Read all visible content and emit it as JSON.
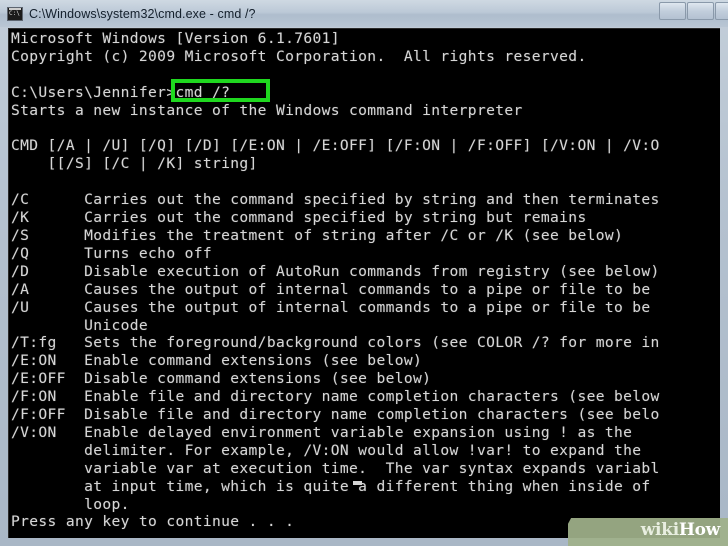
{
  "window": {
    "title": "C:\\Windows\\system32\\cmd.exe - cmd /?",
    "icon": "cmd-console-icon",
    "buttons": [
      {
        "name": "minimize-button",
        "glyph": ""
      },
      {
        "name": "maximize-button",
        "glyph": ""
      },
      {
        "name": "close-button",
        "glyph": ""
      }
    ]
  },
  "console": {
    "background_color": "#000000",
    "text_color": "#d6d6d6",
    "lines": [
      "Microsoft Windows [Version 6.1.7601]",
      "Copyright (c) 2009 Microsoft Corporation.  All rights reserved.",
      "",
      "C:\\Users\\Jennifer>cmd /?",
      "Starts a new instance of the Windows command interpreter",
      "",
      "CMD [/A | /U] [/Q] [/D] [/E:ON | /E:OFF] [/F:ON | /F:OFF] [/V:ON | /V:O",
      "    [[/S] [/C | /K] string]",
      "",
      "/C      Carries out the command specified by string and then terminates",
      "/K      Carries out the command specified by string but remains",
      "/S      Modifies the treatment of string after /C or /K (see below)",
      "/Q      Turns echo off",
      "/D      Disable execution of AutoRun commands from registry (see below)",
      "/A      Causes the output of internal commands to a pipe or file to be",
      "/U      Causes the output of internal commands to a pipe or file to be",
      "        Unicode",
      "/T:fg   Sets the foreground/background colors (see COLOR /? for more in",
      "/E:ON   Enable command extensions (see below)",
      "/E:OFF  Disable command extensions (see below)",
      "/F:ON   Enable file and directory name completion characters (see below",
      "/F:OFF  Disable file and directory name completion characters (see belo",
      "/V:ON   Enable delayed environment variable expansion using ! as the",
      "        delimiter. For example, /V:ON would allow !var! to expand the",
      "        variable var at execution time.  The var syntax expands variabl",
      "        at input time, which is quite a different thing when inside of",
      "        loop.",
      "Press any key to continue . . ."
    ],
    "cursor": "_"
  },
  "annotation": {
    "highlight_target": ">cmd /?",
    "highlight_color": "#1fd81f",
    "shape": "rectangle-outline"
  },
  "watermark": {
    "wiki": "wiki",
    "how": "How",
    "banner_color": "#9fb08a"
  }
}
